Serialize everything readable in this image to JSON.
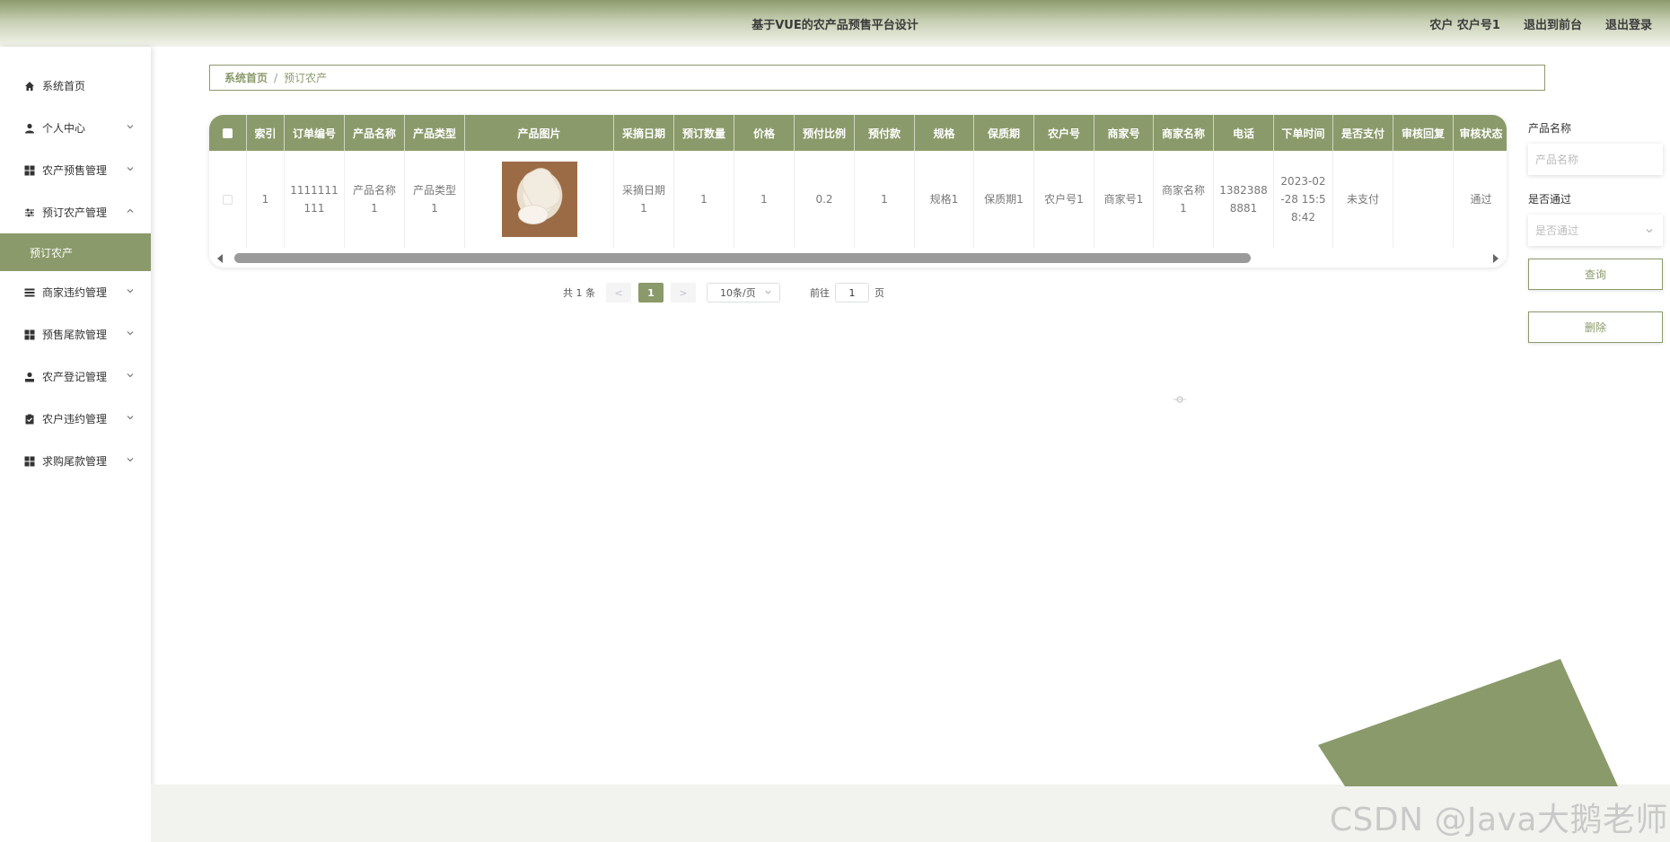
{
  "app": {
    "title": "基于VUE的农产品预售平台设计",
    "user_label": "农户 农户号1",
    "to_front_label": "退出到前台",
    "logout_label": "退出登录"
  },
  "sidebar": {
    "items": [
      {
        "label": "系统首页",
        "icon": "home-icon"
      },
      {
        "label": "个人中心",
        "icon": "user-icon"
      },
      {
        "label": "农产预售管理",
        "icon": "grid-icon"
      },
      {
        "label": "预订农产管理",
        "icon": "sliders-icon",
        "expanded": true
      },
      {
        "label": "商家违约管理",
        "icon": "list-icon"
      },
      {
        "label": "预售尾款管理",
        "icon": "grid-icon"
      },
      {
        "label": "农产登记管理",
        "icon": "person-icon"
      },
      {
        "label": "农户违约管理",
        "icon": "clipboard-icon"
      },
      {
        "label": "求购尾款管理",
        "icon": "grid-icon"
      }
    ],
    "sub_item": "预订农产"
  },
  "breadcrumb": {
    "home": "系统首页",
    "separator": "/",
    "current": "预订农产"
  },
  "table": {
    "columns": [
      "索引",
      "订单编号",
      "产品名称",
      "产品类型",
      "产品图片",
      "采摘日期",
      "预订数量",
      "价格",
      "预付比例",
      "预付款",
      "规格",
      "保质期",
      "农户号",
      "商家号",
      "商家名称",
      "电话",
      "下单时间",
      "是否支付",
      "审核回复",
      "审核状态"
    ],
    "rows": [
      {
        "index": "1",
        "order_no": "1111111111",
        "product_name": "产品名称1",
        "product_type": "产品类型1",
        "image": "white-radish-photo",
        "pick_date": "采摘日期1",
        "quantity": "1",
        "price": "1",
        "prepay_ratio": "0.2",
        "prepay": "1",
        "spec": "规格1",
        "shelf_life": "保质期1",
        "farmer_no": "农户号1",
        "merchant_no": "商家号1",
        "merchant_name": "商家名称1",
        "phone": "13823888881",
        "order_time": "2023-02-28 15:58:42",
        "paid": "未支付",
        "review_reply": "",
        "review_status": "通过"
      }
    ]
  },
  "pagination": {
    "total_text": "共 1 条",
    "prev": "<",
    "current_page": "1",
    "next": ">",
    "page_size": "10条/页",
    "goto_prefix": "前往",
    "goto_value": "1",
    "goto_suffix": "页"
  },
  "search": {
    "product_name_label": "产品名称",
    "product_name_placeholder": "产品名称",
    "passed_label": "是否通过",
    "passed_placeholder": "是否通过",
    "query_button": "查询",
    "delete_button": "删除"
  },
  "watermark": "CSDN @Java大鹅老师",
  "colors": {
    "accent": "#8a9a6a",
    "header_gradient_top": "#8c9a6b",
    "band": "#f2f3ee"
  }
}
